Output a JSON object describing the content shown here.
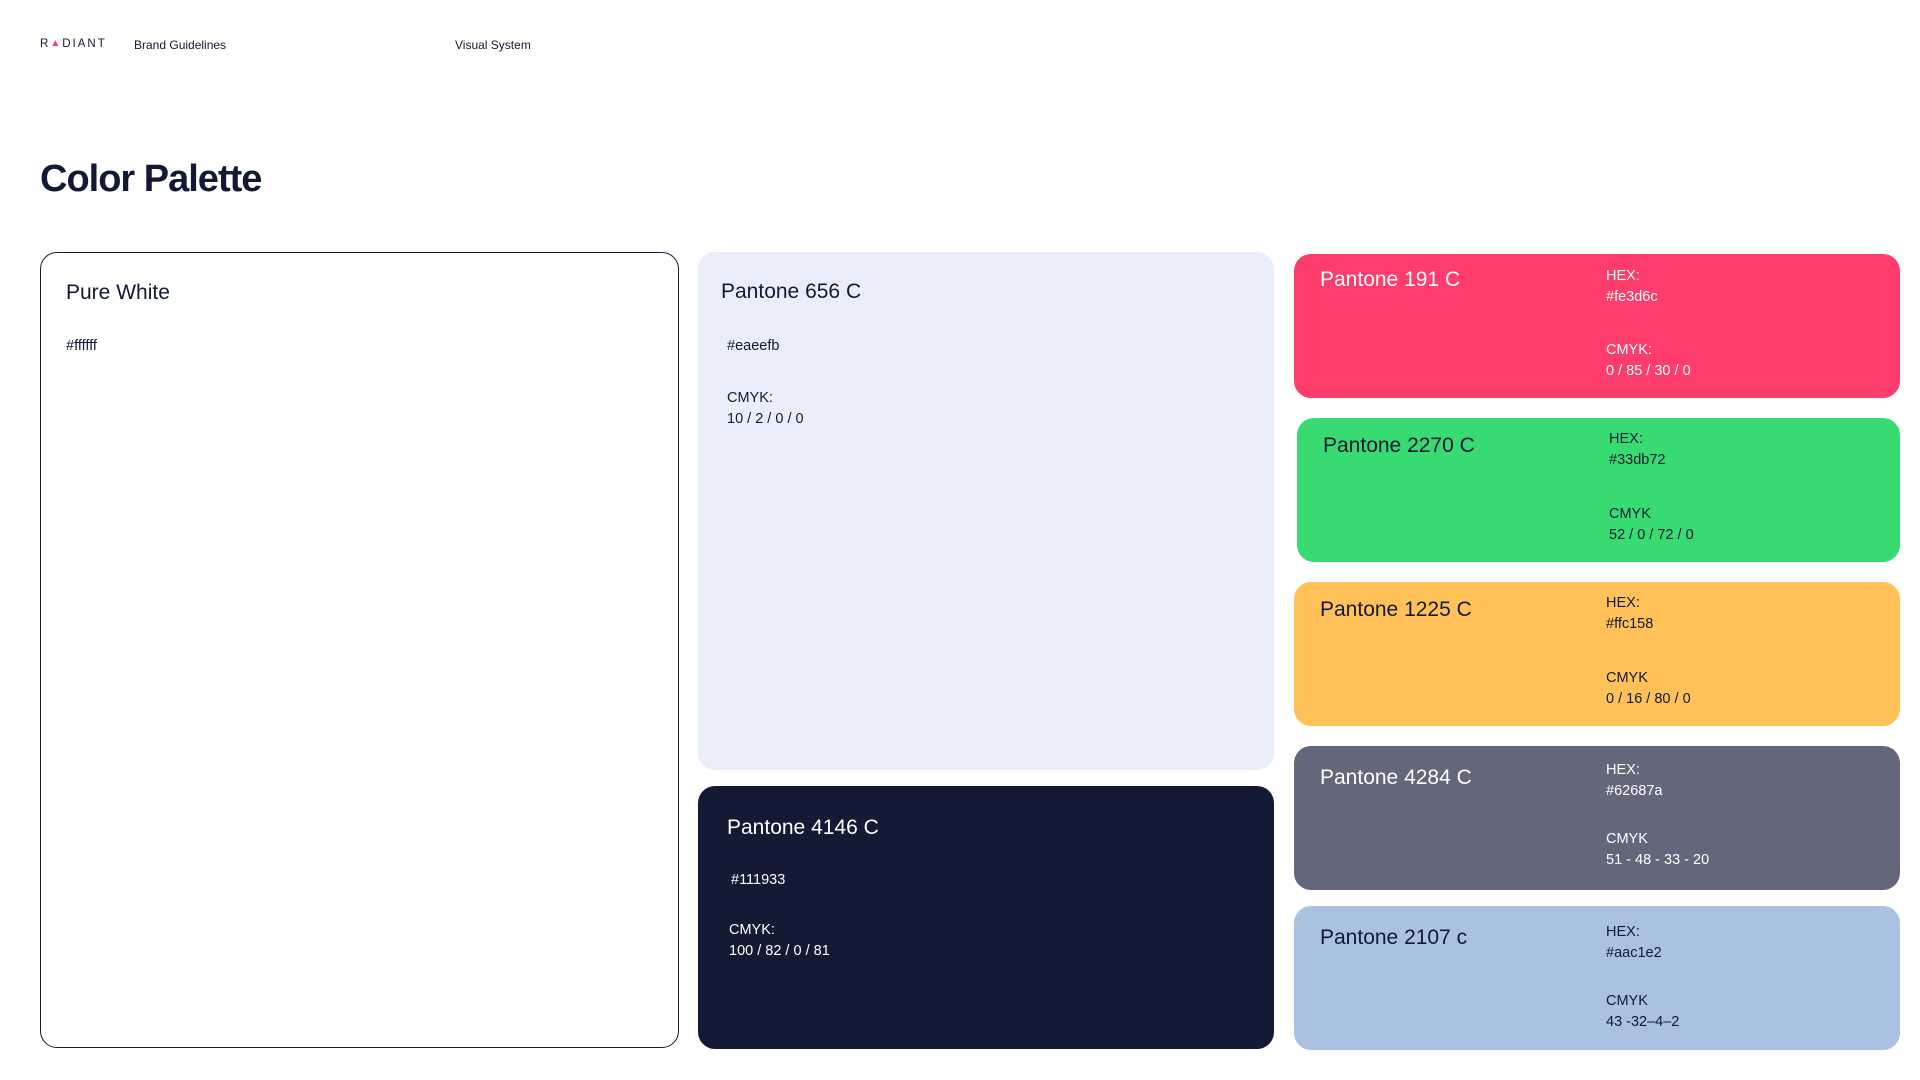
{
  "header": {
    "logo": {
      "prefix": "R",
      "suffix": "DIANT"
    },
    "brand_guidelines": "Brand Guidelines",
    "visual_system": "Visual System"
  },
  "title": "Color Palette",
  "colors": {
    "pure_white": {
      "name": "Pure White",
      "hex": "#ffffff"
    },
    "pantone_656": {
      "name": "Pantone 656 C",
      "hex": "#eaeefb",
      "cmyk_label": "CMYK:",
      "cmyk": "10 / 2 / 0 / 0"
    },
    "pantone_4146": {
      "name": "Pantone 4146 C",
      "hex": "#111933",
      "cmyk_label": "CMYK:",
      "cmyk": "100 / 82 / 0 / 81"
    },
    "pantone_191": {
      "name": "Pantone 191 C",
      "hex_label": "HEX:",
      "hex": "#fe3d6c",
      "cmyk_label": "CMYK:",
      "cmyk": "0 / 85 / 30 / 0"
    },
    "pantone_2270": {
      "name": "Pantone 2270 C",
      "hex_label": "HEX:",
      "hex": "#33db72",
      "cmyk_label": "CMYK",
      "cmyk": "52 / 0 / 72 / 0"
    },
    "pantone_1225": {
      "name": "Pantone 1225 C",
      "hex_label": "HEX:",
      "hex": "#ffc158",
      "cmyk_label": "CMYK",
      "cmyk": "0 / 16 / 80 / 0"
    },
    "pantone_4284": {
      "name": "Pantone 4284 C",
      "hex_label": "HEX:",
      "hex": "#62687a",
      "cmyk_label": "CMYK",
      "cmyk": "51 - 48  - 33 - 20"
    },
    "pantone_2107": {
      "name": "Pantone 2107 c",
      "hex_label": "HEX:",
      "hex": "#aac1e2",
      "cmyk_label": "CMYK",
      "cmyk": "43 -32–4–2"
    }
  },
  "accent_colors": {
    "logo_mark": "#fe3d6c",
    "text_dark": "#111933"
  }
}
